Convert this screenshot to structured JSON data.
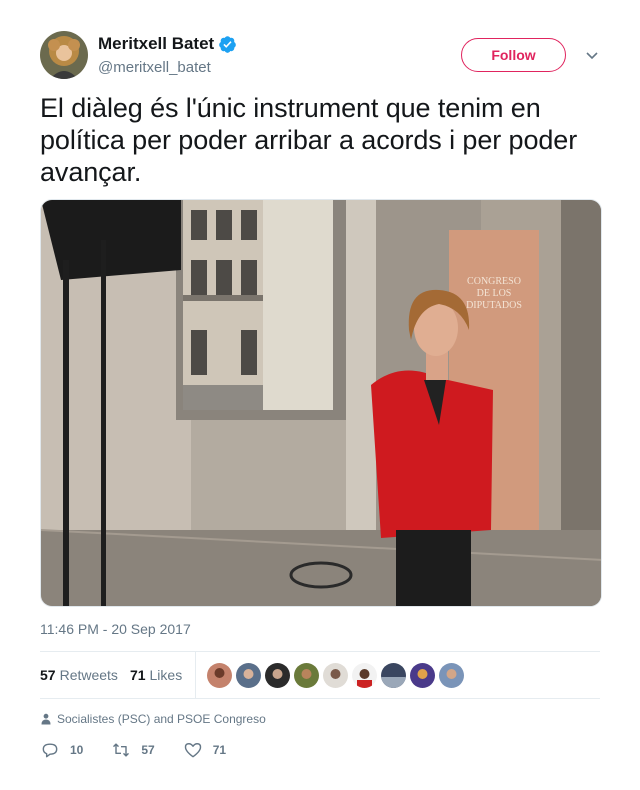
{
  "user": {
    "display_name": "Meritxell Batet",
    "handle": "@meritxell_batet",
    "avatar_icon": "profile-photo",
    "verified_icon": "verified-badge-icon"
  },
  "header": {
    "follow_label": "Follow",
    "menu_icon": "chevron-down-icon"
  },
  "tweet": {
    "text": "El diàleg és l'únic instrument que tenim en política per poder arribar a acords i per poder avançar.",
    "photo_sign": "CONGRESO\nDE LOS\nDIPUTADOS",
    "timestamp": "11:46 PM - 20 Sep 2017"
  },
  "stats": {
    "retweets_count": "57",
    "retweets_label": "Retweets",
    "likes_count": "71",
    "likes_label": "Likes"
  },
  "context": {
    "text": "Socialistes (PSC) and PSOE Congreso"
  },
  "actions": {
    "reply_count": "10",
    "retweet_count": "57",
    "like_count": "71"
  },
  "colors": {
    "accent": "#e0245e",
    "verified": "#1da1f2",
    "muted": "#657786",
    "text": "#14171a"
  }
}
